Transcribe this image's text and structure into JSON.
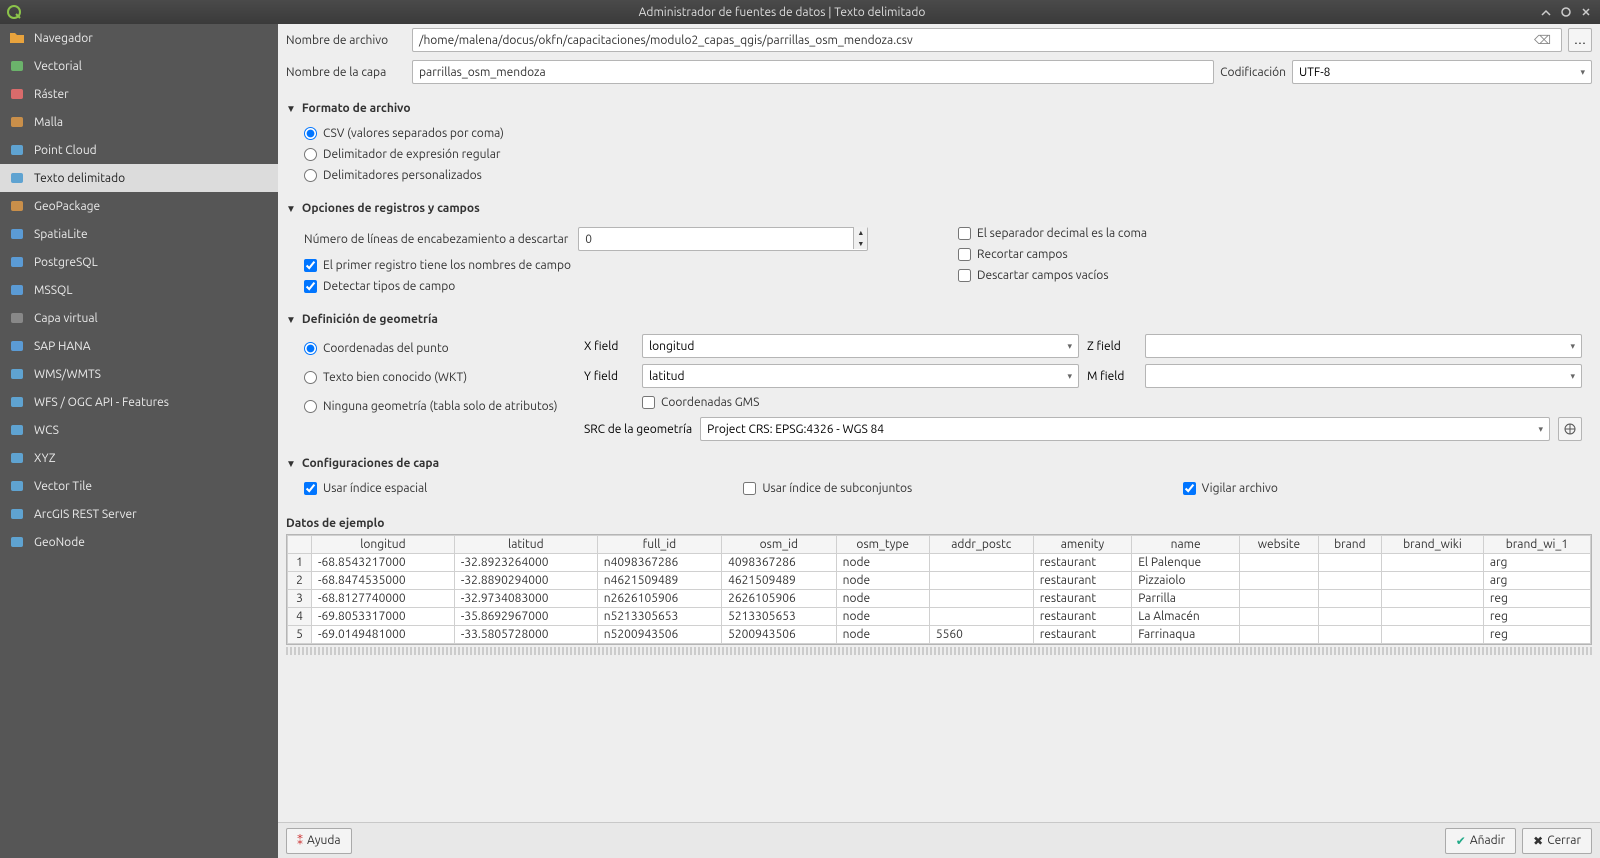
{
  "titlebar": {
    "title": "Administrador de fuentes de datos | Texto delimitado"
  },
  "sidebar": {
    "items": [
      {
        "label": "Navegador"
      },
      {
        "label": "Vectorial"
      },
      {
        "label": "Ráster"
      },
      {
        "label": "Malla"
      },
      {
        "label": "Point Cloud"
      },
      {
        "label": "Texto delimitado"
      },
      {
        "label": "GeoPackage"
      },
      {
        "label": "SpatiaLite"
      },
      {
        "label": "PostgreSQL"
      },
      {
        "label": "MSSQL"
      },
      {
        "label": "Capa virtual"
      },
      {
        "label": "SAP HANA"
      },
      {
        "label": "WMS/WMTS"
      },
      {
        "label": "WFS / OGC API - Features"
      },
      {
        "label": "WCS"
      },
      {
        "label": "XYZ"
      },
      {
        "label": "Vector Tile"
      },
      {
        "label": "ArcGIS REST Server"
      },
      {
        "label": "GeoNode"
      }
    ],
    "selected": 5
  },
  "file": {
    "label": "Nombre de archivo",
    "value": "/home/malena/docus/okfn/capacitaciones/modulo2_capas_qgis/parrillas_osm_mendoza.csv",
    "browse": "…"
  },
  "layer": {
    "label": "Nombre de la capa",
    "value": "parrillas_osm_mendoza",
    "encoding_label": "Codificación",
    "encoding_value": "UTF-8"
  },
  "groups": {
    "format": {
      "title": "Formato de archivo",
      "opt_csv": "CSV (valores separados por coma)",
      "opt_regex": "Delimitador de expresión regular",
      "opt_custom": "Delimitadores personalizados"
    },
    "records": {
      "title": "Opciones de registros y campos",
      "header_lines_label": "Número de líneas de encabezamiento a descartar",
      "header_lines_value": "0",
      "first_record": "El primer registro tiene los nombres de campo",
      "detect_types": "Detectar tipos de campo",
      "decimal_comma": "El separador decimal es la coma",
      "trim": "Recortar campos",
      "discard_empty": "Descartar campos vacíos"
    },
    "geometry": {
      "title": "Definición de geometría",
      "opt_point": "Coordenadas del punto",
      "opt_wkt": "Texto bien conocido (WKT)",
      "opt_none": "Ninguna geometría (tabla solo de atributos)",
      "x_label": "X field",
      "x_value": "longitud",
      "y_label": "Y field",
      "y_value": "latitud",
      "z_label": "Z field",
      "z_value": "",
      "m_label": "M field",
      "m_value": "",
      "dms": "Coordenadas GMS",
      "crs_label": "SRC de la geometría",
      "crs_value": "Project CRS: EPSG:4326 - WGS 84"
    },
    "layer_cfg": {
      "title": "Configuraciones de capa",
      "spatial_index": "Usar índice espacial",
      "subset_index": "Usar índice de subconjuntos",
      "watch_file": "Vigilar archivo"
    }
  },
  "sample": {
    "title": "Datos de ejemplo",
    "headers": [
      "longitud",
      "latitud",
      "full_id",
      "osm_id",
      "osm_type",
      "addr_postc",
      "amenity",
      "name",
      "website",
      "brand",
      "brand_wiki",
      "brand_wi_1"
    ],
    "rows": [
      [
        "-68.8543217000",
        "-32.8923264000",
        "n4098367286",
        "4098367286",
        "node",
        "",
        "restaurant",
        "El Palenque",
        "",
        "",
        "",
        "arg"
      ],
      [
        "-68.8474535000",
        "-32.8890294000",
        "n4621509489",
        "4621509489",
        "node",
        "",
        "restaurant",
        "Pizzaiolo",
        "",
        "",
        "",
        "arg"
      ],
      [
        "-68.8127740000",
        "-32.9734083000",
        "n2626105906",
        "2626105906",
        "node",
        "",
        "restaurant",
        "Parrilla",
        "",
        "",
        "",
        "reg"
      ],
      [
        "-69.8053317000",
        "-35.8692967000",
        "n5213305653",
        "5213305653",
        "node",
        "",
        "restaurant",
        "La Almacén",
        "",
        "",
        "",
        "reg"
      ],
      [
        "-69.0149481000",
        "-33.5805728000",
        "n5200943506",
        "5200943506",
        "node",
        "5560",
        "restaurant",
        "Farrinaqua",
        "",
        "",
        "",
        "reg"
      ]
    ]
  },
  "footer": {
    "help": "Ayuda",
    "add": "Añadir",
    "close": "Cerrar"
  }
}
